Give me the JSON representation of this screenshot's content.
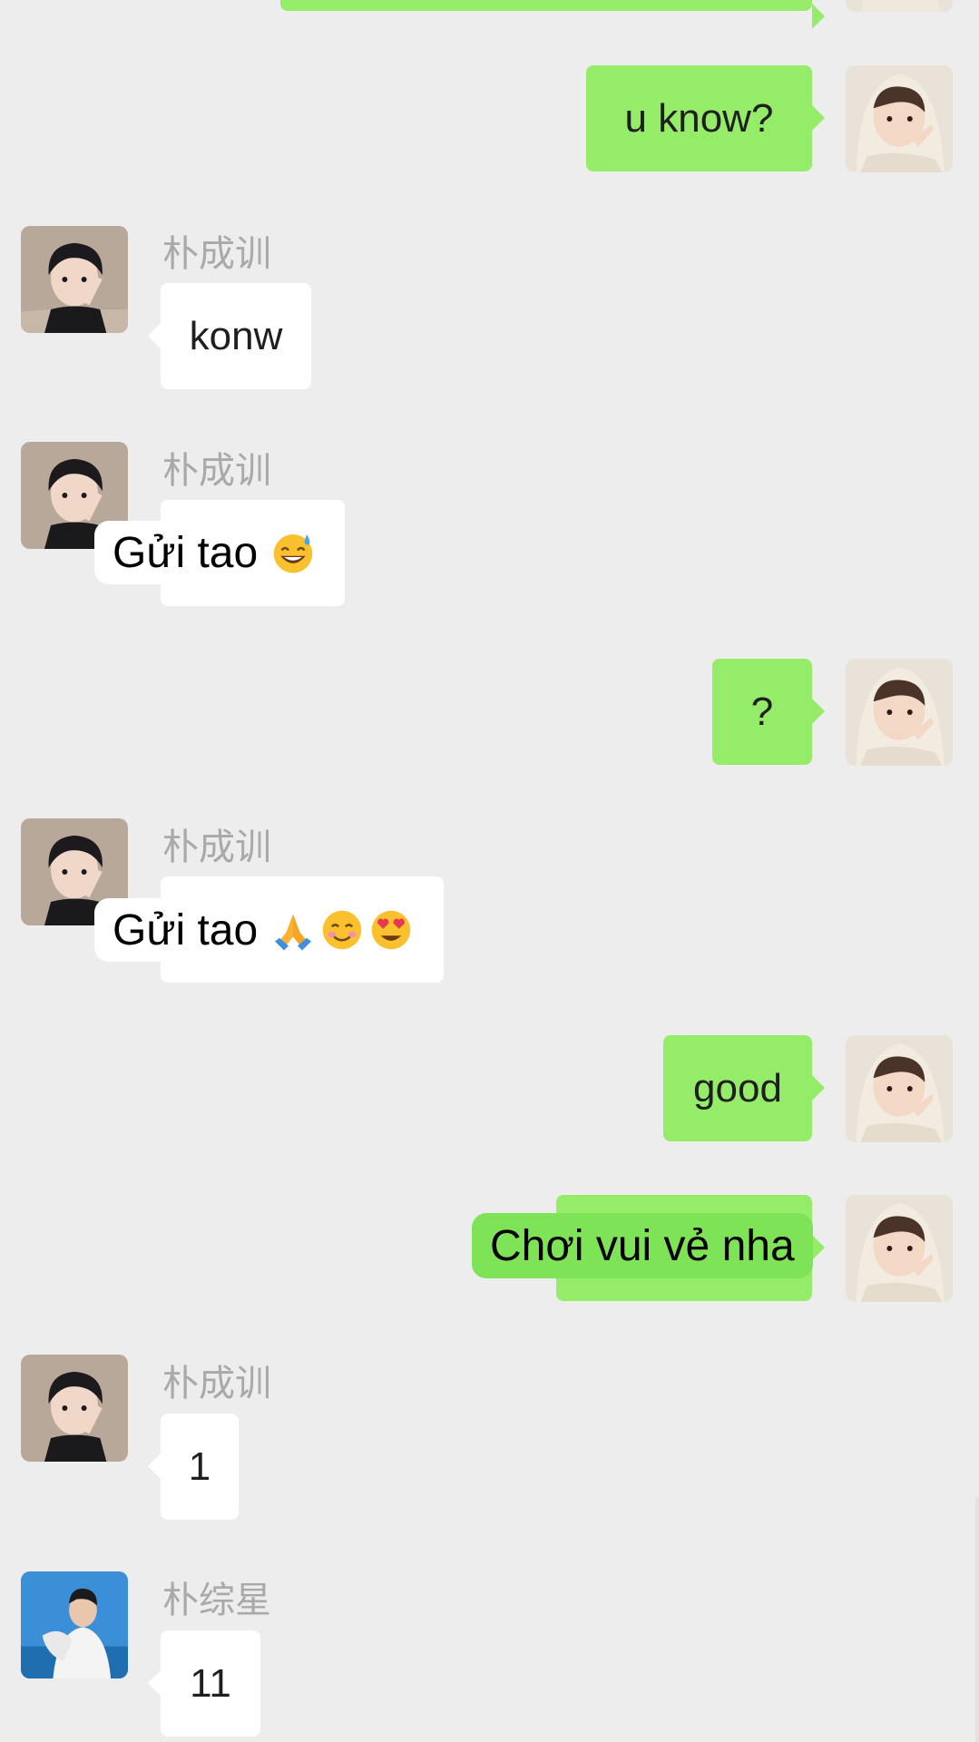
{
  "conversation": {
    "contacts": {
      "contact_a": "朴成训",
      "contact_b": "朴综星"
    },
    "messages": [
      {
        "id": "m1",
        "direction": "out",
        "text": "u know?"
      },
      {
        "id": "m2",
        "direction": "in",
        "sender": "朴成训",
        "text": "konw"
      },
      {
        "id": "m3",
        "direction": "in",
        "sender": "朴成训",
        "text": "",
        "caption": "Gửi tao",
        "caption_emojis": [
          "sweat-smile-emoji"
        ]
      },
      {
        "id": "m4",
        "direction": "out",
        "text": "?"
      },
      {
        "id": "m5",
        "direction": "in",
        "sender": "朴成训",
        "text": "",
        "caption": "Gửi tao",
        "caption_emojis": [
          "folded-hands-emoji",
          "smiling-face-emoji",
          "heart-eyes-emoji"
        ]
      },
      {
        "id": "m6",
        "direction": "out",
        "text": "good"
      },
      {
        "id": "m7",
        "direction": "out",
        "text": "",
        "caption": "Chơi vui vẻ nha"
      },
      {
        "id": "m8",
        "direction": "in",
        "sender": "朴成训",
        "text": "1"
      },
      {
        "id": "m9",
        "direction": "in",
        "sender": "朴综星",
        "text": "11"
      }
    ]
  },
  "colors": {
    "background": "#ededed",
    "outgoing_bubble": "#95ec69",
    "incoming_bubble": "#ffffff",
    "sender_name": "#a9a9a9",
    "caption_green": "#7ee357"
  }
}
